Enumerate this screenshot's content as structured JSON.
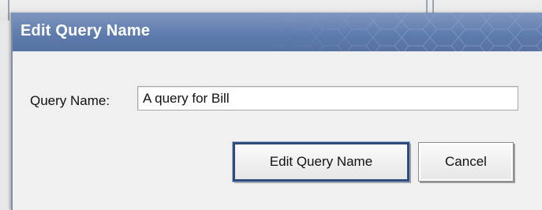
{
  "dialog": {
    "title": "Edit Query Name",
    "field_label": "Query Name:",
    "field_value": "A query for Bill",
    "primary_button": "Edit Query Name",
    "cancel_button": "Cancel"
  },
  "colors": {
    "title_bar": "#5d7aad",
    "title_text": "#ffffff",
    "primary_border": "#2e4b7a",
    "dialog_bg": "#f0f0f0"
  }
}
